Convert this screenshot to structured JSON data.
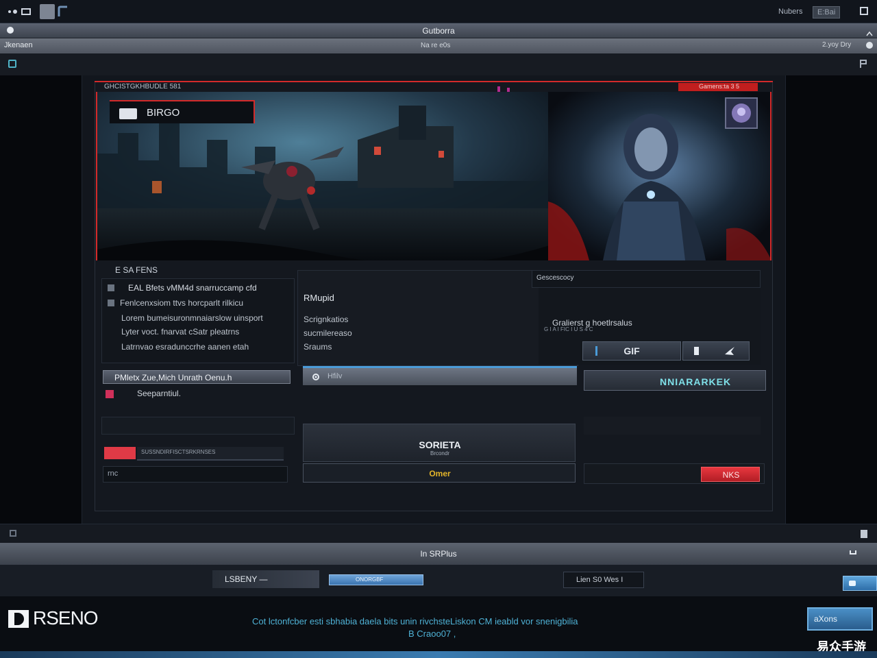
{
  "topbar": {
    "right_label": "Nubers",
    "right_button": "E:Bai"
  },
  "titlebar": {
    "title": "Gutborra"
  },
  "addressbar": {
    "left_text": "Jkenaen",
    "center_text": "Na  re e0s",
    "right_text": "2.yoy  Dry"
  },
  "frame": {
    "header_text": "GHCISTGKHBUDLE 581",
    "header_badge": "Gamens:ta  3 5"
  },
  "hero": {
    "label": "BIRGO"
  },
  "left_panel": {
    "heading": "E  SA  FENS",
    "lines": [
      "EAL  Bfets vMM4d snarruccamp cfd",
      "Fenlcenxsiom ttvs horcparlt rilkicu",
      "Lorem  bumeisuronmnaiarslow uinsport",
      "Lyter voct. fnarvat cSatr pleatrns",
      "Latrnvao esradunccrhe aanen etah"
    ],
    "highlight_bar": "PMletx Zue,Mich Unrath Oenu.h",
    "link_text": "Seeparntiul.",
    "progress_caption": "SUSSNDIRFISCTSRKRNSES",
    "input_placeholder": "rnc"
  },
  "middle_panel": {
    "heading": "RMupid",
    "lines": [
      "Scrignkatios",
      "sucmilereaso",
      "Sraums"
    ],
    "search_placeholder": "Hfilv",
    "button_label": "SORIETA",
    "button_sub": "Brcondr",
    "select_label": "Omer"
  },
  "right_panel": {
    "top_label": "Gescescocy",
    "caption": "Gralierst g hoetlrsalus",
    "caption_sub": "G I A  I FIC  I U  S  4 C",
    "gif_button": "GIF",
    "wide_button": "NNIARARKEK",
    "red_button": "NKS"
  },
  "status": {
    "center_text": "In SRPlus"
  },
  "controls": {
    "left_label": "LSBENY —",
    "progress_label": "ONORGBF",
    "right_label": "Lien  S0 Wes  I"
  },
  "footer": {
    "logo_text": "RSENO",
    "message_line1": "Cot lctonfcber esti  sbhabia daela  bits  unin  rivchsteLiskon  CM ieabld vor snenigbilia",
    "message_line2": "B   Craoo07  ,",
    "action_button": "aXons",
    "watermark": "易众手游"
  },
  "colors": {
    "accent_red": "#d42a2a",
    "accent_blue": "#4a9bd8",
    "accent_yellow": "#e3b42a"
  }
}
